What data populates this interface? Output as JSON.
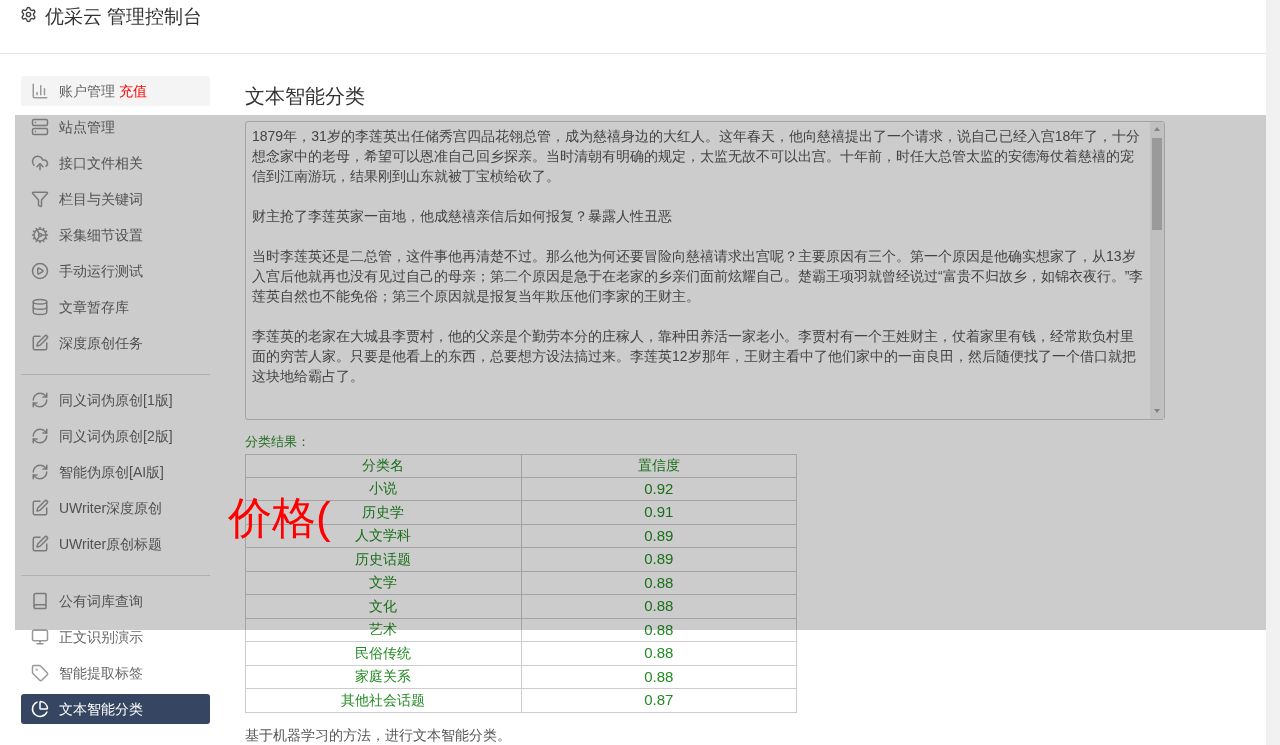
{
  "header": {
    "title": "优采云 管理控制台"
  },
  "sidebar": {
    "groups": [
      [
        {
          "kind": "chart",
          "label": "账户管理",
          "badge": "充值",
          "selected": false
        },
        {
          "kind": "server",
          "label": "站点管理",
          "selected": false
        },
        {
          "kind": "cloud",
          "label": "接口文件相关",
          "selected": false
        },
        {
          "kind": "filter",
          "label": "栏目与关键词",
          "selected": false
        },
        {
          "kind": "gears",
          "label": "采集细节设置",
          "selected": false
        },
        {
          "kind": "play",
          "label": "手动运行测试",
          "selected": false
        },
        {
          "kind": "database",
          "label": "文章暂存库",
          "selected": false
        },
        {
          "kind": "edit",
          "label": "深度原创任务",
          "selected": false
        }
      ],
      [
        {
          "kind": "refresh",
          "label": "同义词伪原创[1版]",
          "selected": false
        },
        {
          "kind": "refresh",
          "label": "同义词伪原创[2版]",
          "selected": false
        },
        {
          "kind": "refresh",
          "label": "智能伪原创[AI版]",
          "selected": false
        },
        {
          "kind": "edit",
          "label": "UWriter深度原创",
          "selected": false
        },
        {
          "kind": "edit",
          "label": "UWriter原创标题",
          "selected": false
        }
      ],
      [
        {
          "kind": "book",
          "label": "公有词库查询",
          "selected": false
        },
        {
          "kind": "monitor",
          "label": "正文识别演示",
          "selected": false
        },
        {
          "kind": "tag",
          "label": "智能提取标签",
          "selected": false
        },
        {
          "kind": "pie",
          "label": "文本智能分类",
          "selected": true
        }
      ]
    ]
  },
  "main": {
    "title": "文本智能分类",
    "input_text": [
      "1879年，31岁的李莲英出任储秀宫四品花翎总管，成为慈禧身边的大红人。这年春天，他向慈禧提出了一个请求，说自己已经入宫18年了，十分想念家中的老母，希望可以恩准自己回乡探亲。当时清朝有明确的规定，太监无故不可以出宫。十年前，时任大总管太监的安德海仗着慈禧的宠信到江南游玩，结果刚到山东就被丁宝桢给砍了。",
      "财主抢了李莲英家一亩地，他成慈禧亲信后如何报复？暴露人性丑恶",
      "当时李莲英还是二总管，这件事他再清楚不过。那么他为何还要冒险向慈禧请求出宫呢？主要原因有三个。第一个原因是他确实想家了，从13岁入宫后他就再也没有见过自己的母亲；第二个原因是急于在老家的乡亲们面前炫耀自己。楚霸王项羽就曾经说过“富贵不归故乡，如锦衣夜行。”李莲英自然也不能免俗；第三个原因就是报复当年欺压他们李家的王财主。",
      "李莲英的老家在大城县李贾村，他的父亲是个勤劳本分的庄稼人，靠种田养活一家老小。李贾村有一个王姓财主，仗着家里有钱，经常欺负村里面的穷苦人家。只要是他看上的东西，总要想方设法搞过来。李莲英12岁那年，王财主看中了他们家中的一亩良田，然后随便找了一个借口就把这块地给霸占了。"
    ],
    "results_label": "分类结果：",
    "table": {
      "columns": [
        "分类名",
        "置信度"
      ],
      "rows": [
        [
          "小说",
          "0.92"
        ],
        [
          "历史学",
          "0.91"
        ],
        [
          "人文学科",
          "0.89"
        ],
        [
          "历史话题",
          "0.89"
        ],
        [
          "文学",
          "0.88"
        ],
        [
          "文化",
          "0.88"
        ],
        [
          "艺术",
          "0.88"
        ],
        [
          "民俗传统",
          "0.88"
        ],
        [
          "家庭关系",
          "0.88"
        ],
        [
          "其他社会话题",
          "0.87"
        ]
      ]
    },
    "description": "基于机器学习的方法，进行文本智能分类。"
  },
  "overlay": {
    "text": "价格("
  }
}
